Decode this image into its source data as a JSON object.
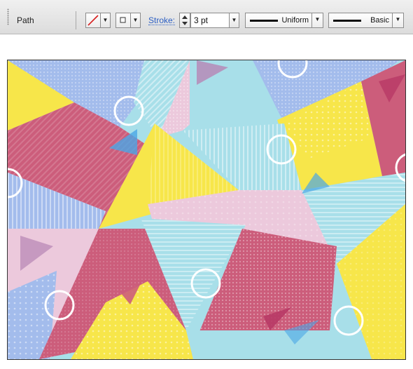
{
  "control_bar": {
    "selection_type": "Path",
    "stroke_label": "Stroke:",
    "stroke_weight": "3 pt",
    "variable_width_profile": "Uniform",
    "brush_definition": "Basic",
    "icons": {
      "fill": "no-fill-slash-swatch-icon",
      "stroke_swatch": "stroke-swatch-icon",
      "stepper": "stepper-icon",
      "dropdown": "chevron-down-icon"
    }
  },
  "artwork": {
    "palette": {
      "yellow": "#f7e64a",
      "pink": "#cc5d7b",
      "blue": "#a3bcec",
      "cyan": "#a8dfe9",
      "light_pink": "#ecc9dc",
      "accent_blue": "#4aa6e6",
      "circle_stroke": "#ffffff"
    }
  }
}
